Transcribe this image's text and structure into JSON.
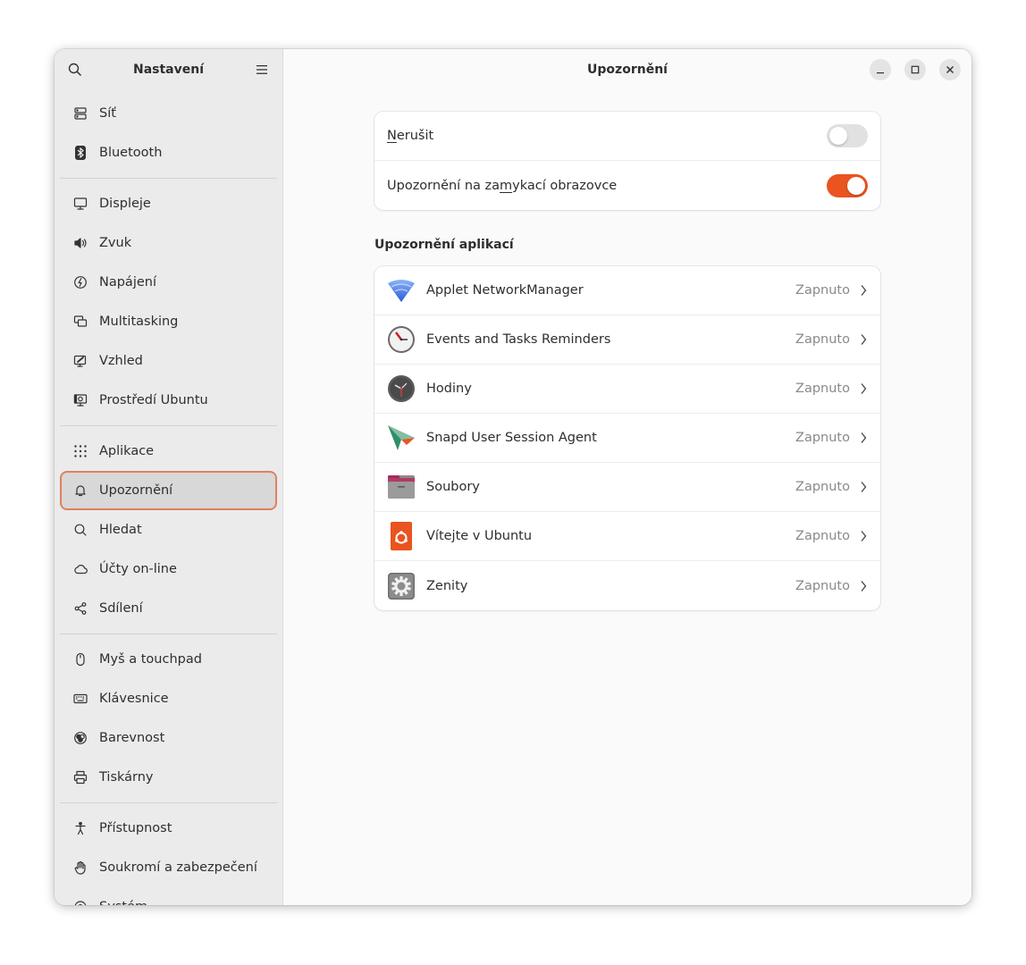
{
  "sidebar": {
    "title": "Nastavení",
    "groups": [
      [
        {
          "label": "Síť",
          "icon": "network-icon"
        },
        {
          "label": "Bluetooth",
          "icon": "bluetooth-icon"
        }
      ],
      [
        {
          "label": "Displeje",
          "icon": "display-icon"
        },
        {
          "label": "Zvuk",
          "icon": "speaker-icon"
        },
        {
          "label": "Napájení",
          "icon": "power-icon"
        },
        {
          "label": "Multitasking",
          "icon": "multitasking-icon"
        },
        {
          "label": "Vzhled",
          "icon": "appearance-icon"
        },
        {
          "label": "Prostředí Ubuntu",
          "icon": "ubuntu-desktop-icon"
        }
      ],
      [
        {
          "label": "Aplikace",
          "icon": "apps-grid-icon"
        },
        {
          "label": "Upozornění",
          "icon": "bell-icon",
          "active": true
        },
        {
          "label": "Hledat",
          "icon": "search-icon"
        },
        {
          "label": "Účty on-line",
          "icon": "cloud-icon"
        },
        {
          "label": "Sdílení",
          "icon": "share-icon"
        }
      ],
      [
        {
          "label": "Myš a touchpad",
          "icon": "mouse-icon"
        },
        {
          "label": "Klávesnice",
          "icon": "keyboard-icon"
        },
        {
          "label": "Barevnost",
          "icon": "color-icon"
        },
        {
          "label": "Tiskárny",
          "icon": "printer-icon"
        }
      ],
      [
        {
          "label": "Přístupnost",
          "icon": "accessibility-icon"
        },
        {
          "label": "Soukromí a zabezpečení",
          "icon": "hand-icon"
        },
        {
          "label": "Systém",
          "icon": "system-icon"
        }
      ]
    ]
  },
  "header": {
    "title": "Upozornění"
  },
  "toggles": {
    "dnd": {
      "label_pre": "",
      "label_u": "N",
      "label_post": "erušit",
      "on": false
    },
    "lock": {
      "label_pre": "Upozornění na za",
      "label_u": "m",
      "label_post": "ykací obrazovce",
      "on": true
    }
  },
  "apps_section": {
    "title": "Upozornění aplikací",
    "items": [
      {
        "name": "Applet NetworkManager",
        "status": "Zapnuto",
        "icon": "network-manager-icon"
      },
      {
        "name": "Events and Tasks Reminders",
        "status": "Zapnuto",
        "icon": "reminders-clock-icon"
      },
      {
        "name": "Hodiny",
        "status": "Zapnuto",
        "icon": "clocks-icon"
      },
      {
        "name": "Snapd User Session Agent",
        "status": "Zapnuto",
        "icon": "snapd-icon"
      },
      {
        "name": "Soubory",
        "status": "Zapnuto",
        "icon": "files-icon"
      },
      {
        "name": "Vítejte v Ubuntu",
        "status": "Zapnuto",
        "icon": "ubuntu-welcome-icon"
      },
      {
        "name": "Zenity",
        "status": "Zapnuto",
        "icon": "zenity-gear-icon"
      }
    ]
  },
  "colors": {
    "accent": "#e95420",
    "active_border": "#e0805b"
  }
}
